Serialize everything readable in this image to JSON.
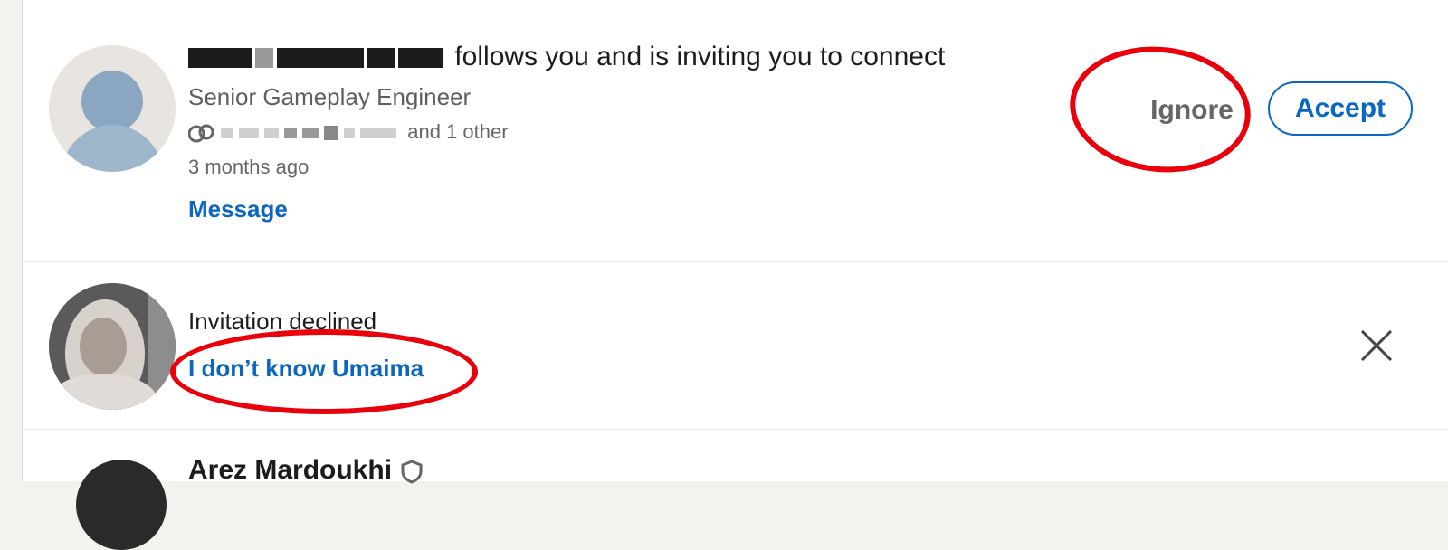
{
  "invitation": {
    "name_redacted": true,
    "headline_suffix": "follows you and is inviting you to connect",
    "title": "Senior Gameplay Engineer",
    "mutual_icon": "mutual-connections-icon",
    "mutual_suffix": "and 1 other",
    "time_ago": "3 months ago",
    "message_label": "Message",
    "ignore_label": "Ignore",
    "accept_label": "Accept"
  },
  "declined": {
    "status_text": "Invitation declined",
    "dont_know_label": "I don’t know Umaima",
    "close_icon": "close-icon"
  },
  "next_item": {
    "name_partial": "Arez Mardoukhi",
    "badge_icon": "verified-shield-icon"
  },
  "colors": {
    "link_blue": "#0a66c2",
    "annotation_red": "#e8000b",
    "avatar_placeholder": "#9db6cc"
  }
}
